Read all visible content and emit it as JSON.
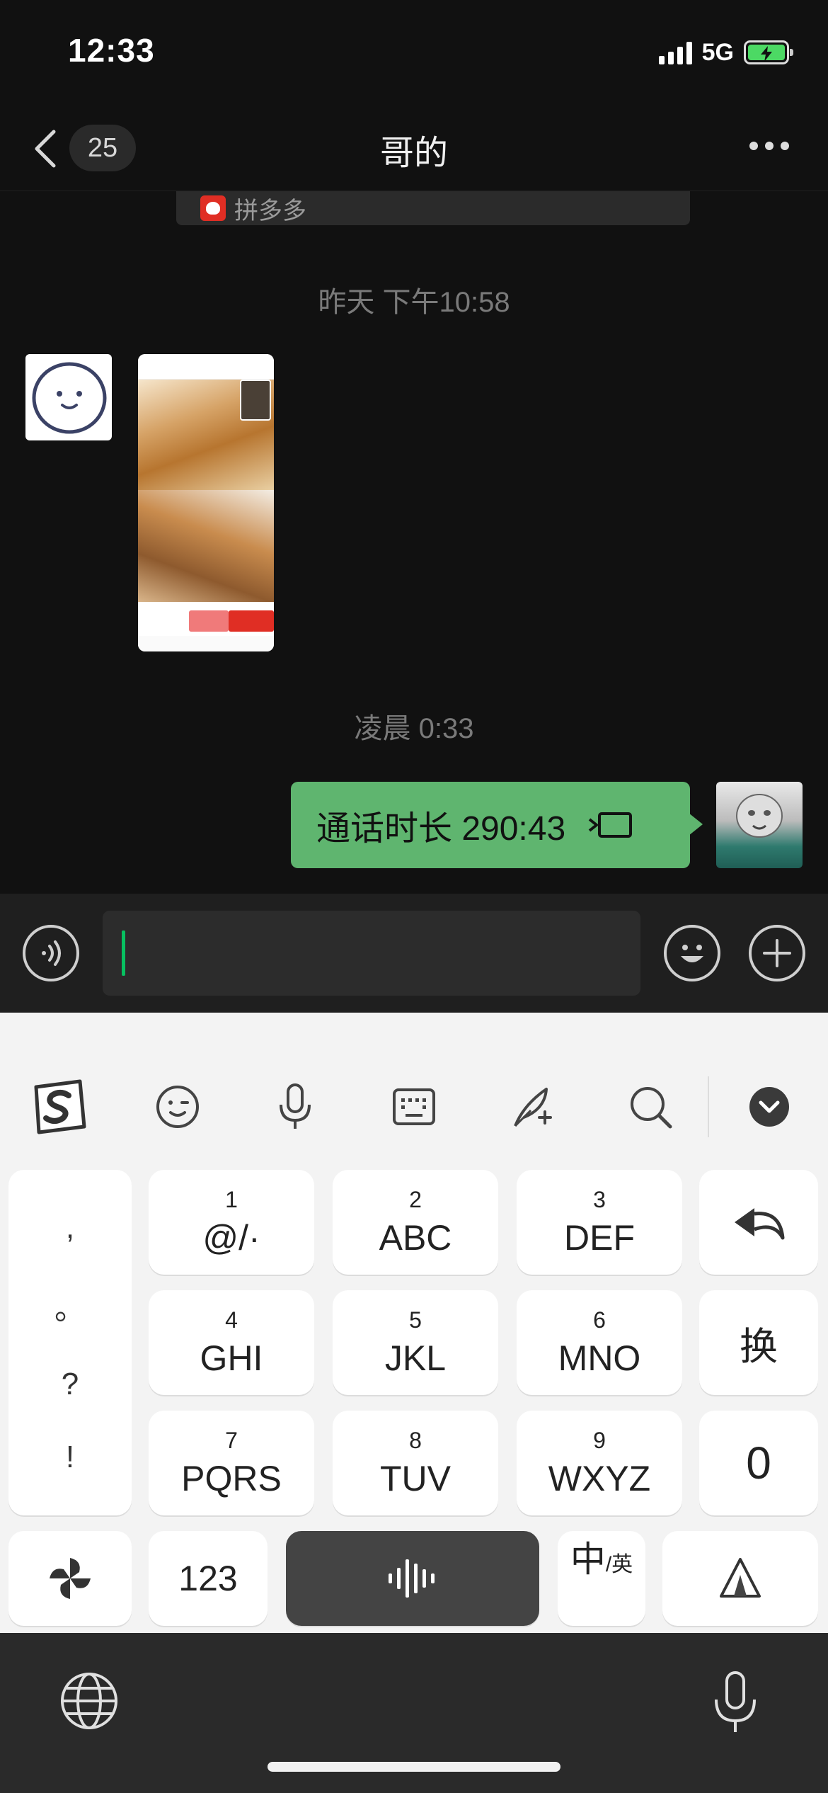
{
  "status_bar": {
    "time": "12:33",
    "network": "5G"
  },
  "nav": {
    "back_count": "25",
    "title": "哥的"
  },
  "chat": {
    "quote_text": "拼多多",
    "timestamp_1": "昨天 下午10:58",
    "timestamp_2": "凌晨 0:33",
    "call_message": "通话时长 290:43"
  },
  "keyboard": {
    "keys": [
      {
        "num": "1",
        "letters": "@/·"
      },
      {
        "num": "2",
        "letters": "ABC"
      },
      {
        "num": "3",
        "letters": "DEF"
      },
      {
        "num": "4",
        "letters": "GHI"
      },
      {
        "num": "5",
        "letters": "JKL"
      },
      {
        "num": "6",
        "letters": "MNO"
      },
      {
        "num": "7",
        "letters": "PQRS"
      },
      {
        "num": "8",
        "letters": "TUV"
      },
      {
        "num": "9",
        "letters": "WXYZ"
      }
    ],
    "punctuation": [
      ",",
      "。",
      "?",
      "!"
    ],
    "switch_label": "换",
    "zero_label": "0",
    "num_label": "123",
    "lang_main": "中",
    "lang_sub": "/英"
  },
  "colors": {
    "bubble_green": "#5fb56f",
    "accent_cursor": "#07c160",
    "dark_bg": "#111111"
  }
}
